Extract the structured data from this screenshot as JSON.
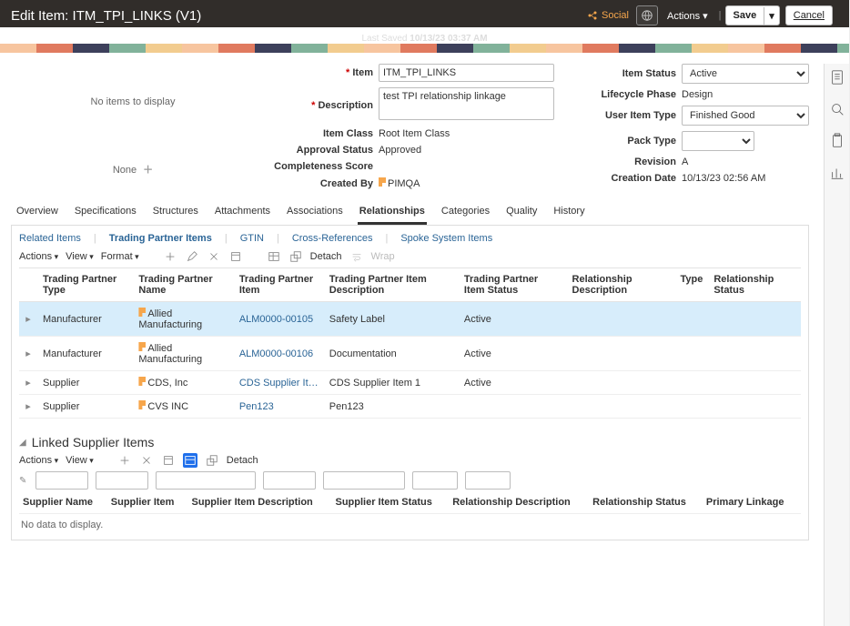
{
  "header": {
    "title": "Edit Item: ITM_TPI_LINKS (V1)",
    "social_label": "Social",
    "actions_label": "Actions",
    "save_label": "Save",
    "cancel_label": "Cancel",
    "last_saved_prefix": "Last Saved",
    "last_saved_value": "10/13/23 03:37 AM"
  },
  "leftcol": {
    "no_items": "No items to display",
    "none_label": "None"
  },
  "form": {
    "item_label": "Item",
    "item_value": "ITM_TPI_LINKS",
    "description_label": "Description",
    "description_value": "test TPI relationship linkage",
    "item_class_label": "Item Class",
    "item_class_value": "Root Item Class",
    "approval_label": "Approval Status",
    "approval_value": "Approved",
    "completeness_label": "Completeness Score",
    "created_by_label": "Created By",
    "created_by_value": "PIMQA",
    "item_status_label": "Item Status",
    "item_status_value": "Active",
    "lifecycle_label": "Lifecycle Phase",
    "lifecycle_value": "Design",
    "user_item_type_label": "User Item Type",
    "user_item_type_value": "Finished Good",
    "pack_type_label": "Pack Type",
    "revision_label": "Revision",
    "revision_value": "A",
    "creation_date_label": "Creation Date",
    "creation_date_value": "10/13/23 02:56 AM"
  },
  "tabs": [
    "Overview",
    "Specifications",
    "Structures",
    "Attachments",
    "Associations",
    "Relationships",
    "Categories",
    "Quality",
    "History"
  ],
  "active_tab": "Relationships",
  "subtabs": [
    "Related Items",
    "Trading Partner Items",
    "GTIN",
    "Cross-References",
    "Spoke System Items"
  ],
  "active_subtab": "Trading Partner Items",
  "toolbar": {
    "actions": "Actions",
    "view": "View",
    "format": "Format",
    "detach": "Detach",
    "wrap": "Wrap"
  },
  "tpi_table": {
    "cols": [
      "Trading Partner Type",
      "Trading Partner Name",
      "Trading Partner Item",
      "Trading Partner Item Description",
      "Trading Partner Item Status",
      "Relationship Description",
      "Type",
      "Relationship Status"
    ],
    "rows": [
      {
        "type": "Manufacturer",
        "name": "Allied Manufacturing",
        "item": "ALM0000-00105",
        "desc": "Safety Label",
        "status": "Active",
        "reldesc": "",
        "reltype": "",
        "relstatus": "",
        "flag": true,
        "sel": true
      },
      {
        "type": "Manufacturer",
        "name": "Allied Manufacturing",
        "item": "ALM0000-00106",
        "desc": "Documentation",
        "status": "Active",
        "reldesc": "",
        "reltype": "",
        "relstatus": "",
        "flag": true
      },
      {
        "type": "Supplier",
        "name": "CDS, Inc",
        "item": "CDS Supplier It…",
        "desc": "CDS Supplier Item 1",
        "status": "Active",
        "reldesc": "",
        "reltype": "",
        "relstatus": "",
        "flag": true
      },
      {
        "type": "Supplier",
        "name": "CVS INC",
        "item": "Pen123",
        "desc": "Pen123",
        "status": "",
        "reldesc": "",
        "reltype": "",
        "relstatus": "",
        "flag": true
      }
    ]
  },
  "linked": {
    "title": "Linked Supplier Items",
    "cols": [
      "Supplier Name",
      "Supplier Item",
      "Supplier Item Description",
      "Supplier Item Status",
      "Relationship Description",
      "Relationship Status",
      "Primary Linkage"
    ],
    "no_data": "No data to display."
  }
}
